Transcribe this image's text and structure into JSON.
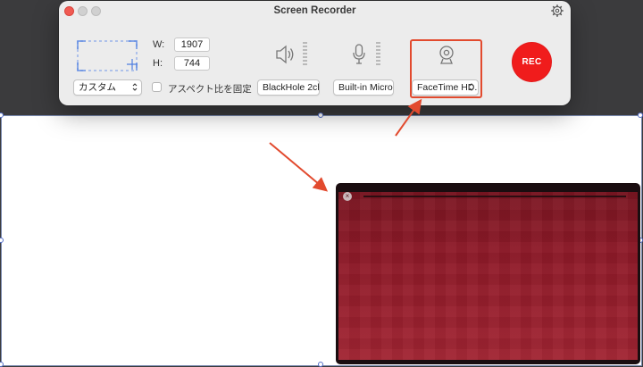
{
  "window": {
    "title": "Screen Recorder"
  },
  "capture": {
    "width_label": "W:",
    "height_label": "H:",
    "width_value": "1907",
    "height_value": "744",
    "preset": "カスタム",
    "aspect_lock_label": "アスペクト比を固定",
    "aspect_lock_checked": false
  },
  "audio": {
    "system_source": "BlackHole 2ch",
    "mic_source": "Built-in Micro..."
  },
  "camera": {
    "source": "FaceTime HD..."
  },
  "record_button_label": "REC",
  "colors": {
    "rec": "#f01c1c",
    "highlight": "#e24a2e",
    "selection": "#5670c9",
    "preview": "#8e1a28"
  },
  "icons": [
    "close-icon",
    "minimize-icon",
    "maximize-icon",
    "gear-icon",
    "selection-area-icon",
    "move-icon",
    "speaker-icon",
    "microphone-icon",
    "webcam-icon",
    "chevron-updown-icon"
  ]
}
